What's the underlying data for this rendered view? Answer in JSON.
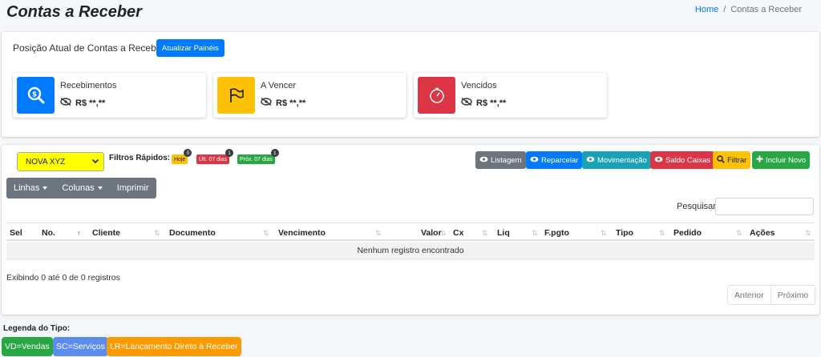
{
  "header": {
    "title": "Contas a Receber",
    "breadcrumb": {
      "home": "Home",
      "separator": "/",
      "current": "Contas a Receber"
    }
  },
  "position_panel": {
    "title": "Posição Atual de Contas a Receber",
    "refresh_label": "Atualizar Painéis",
    "boxes": [
      {
        "label": "Recebimentos",
        "value": "R$ **,**",
        "icon": "search-dollar-icon",
        "color": "#007bff"
      },
      {
        "label": "A Vencer",
        "value": "R$ **,**",
        "icon": "flag-icon",
        "color": "#ffc107"
      },
      {
        "label": "Vencidos",
        "value": "R$ **,**",
        "icon": "stopwatch-icon",
        "color": "#dc3545"
      }
    ]
  },
  "filters": {
    "company_select": "NOVA XYZ",
    "quick_label": "Filtros Rápidos:",
    "quick": [
      {
        "label": "Hoje",
        "count": "0",
        "color": "#ffc107",
        "text_color": "#212529"
      },
      {
        "label": "Últ. 07 dias",
        "count": "1",
        "color": "#dc3545",
        "text_color": "#ffffff"
      },
      {
        "label": "Próx. 07 dias",
        "count": "1",
        "color": "#28a745",
        "text_color": "#ffffff"
      }
    ]
  },
  "actions": [
    {
      "label": "Listagem",
      "icon": "eye-icon",
      "color": "#6c757d"
    },
    {
      "label": "Reparcelar",
      "icon": "eye-icon",
      "color": "#007bff"
    },
    {
      "label": "Movimentação",
      "icon": "eye-icon",
      "color": "#17a2b8"
    },
    {
      "label": "Saldo Caixas",
      "icon": "eye-icon",
      "color": "#dc3545"
    },
    {
      "label": "Filtrar",
      "icon": "search-icon",
      "color": "#ffc107"
    },
    {
      "label": "Incluir Novo",
      "icon": "plus-icon",
      "color": "#28a745"
    }
  ],
  "table_tools": {
    "rows": "Linhas",
    "columns": "Colunas",
    "print": "Imprimir"
  },
  "search": {
    "label": "Pesquisar",
    "placeholder": ""
  },
  "table": {
    "columns": [
      "Sel",
      "No.",
      "Cliente",
      "Documento",
      "Vencimento",
      "Valor",
      "Cx",
      "Liq",
      "F.pgto",
      "Tipo",
      "Pedido",
      "Ações"
    ],
    "empty_message": "Nenhum registro encontrado",
    "showing": "Exibindo 0 até 0 de 0 registros",
    "prev": "Anterior",
    "next": "Próximo"
  },
  "legend": {
    "title": "Legenda do Tipo:",
    "items": [
      {
        "label": "VD=Vendas",
        "color": "#28a745"
      },
      {
        "label": "SC=Serviços",
        "color": "#5b8def"
      },
      {
        "label": "LR=Lançamento Direto à Receber",
        "color": "#fd9a00"
      }
    ]
  }
}
